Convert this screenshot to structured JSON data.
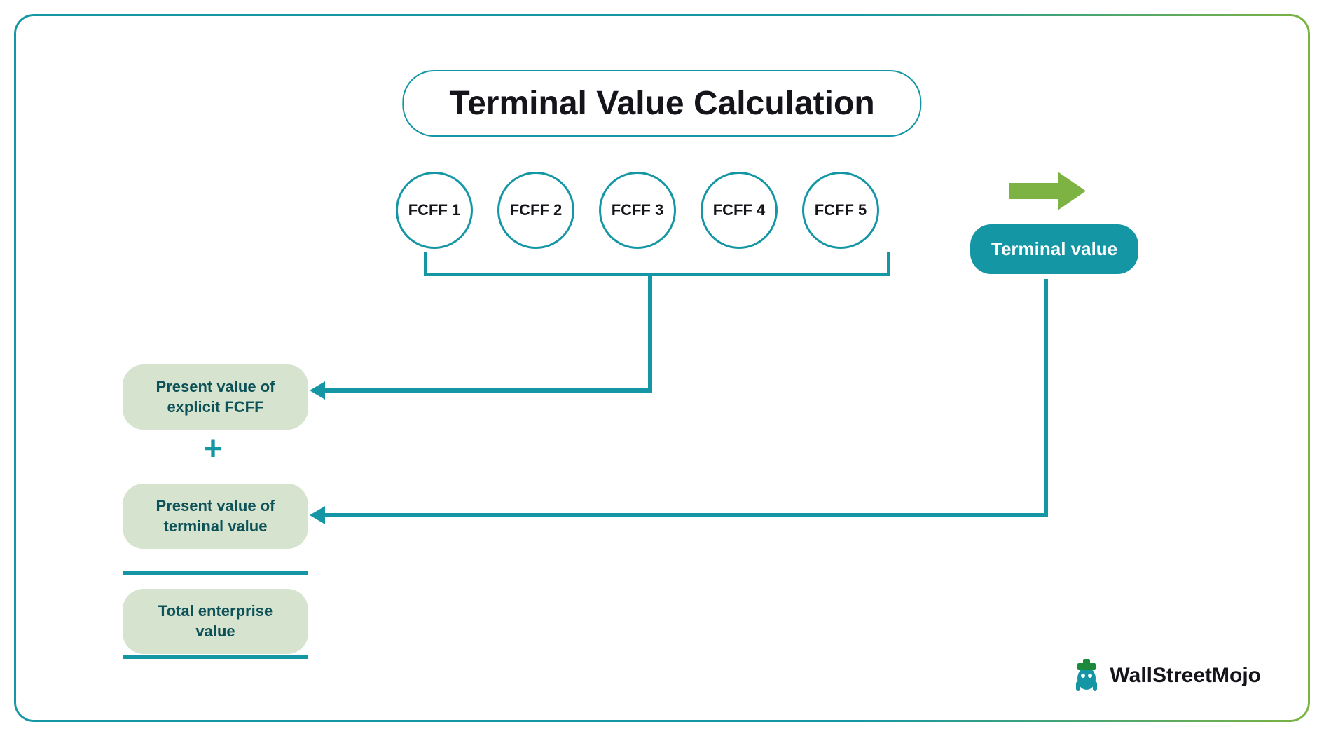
{
  "title": "Terminal Value Calculation",
  "fcff": [
    "FCFF 1",
    "FCFF 2",
    "FCFF 3",
    "FCFF 4",
    "FCFF 5"
  ],
  "terminal_value_label": "Terminal value",
  "boxes": {
    "pv_explicit": "Present value of explicit FCFF",
    "pv_terminal": "Present value of terminal value",
    "total_ev": "Total enterprise value"
  },
  "plus_symbol": "+",
  "logo_text": "WallStreetMojo",
  "colors": {
    "teal": "#1596a5",
    "green": "#7cb342",
    "light_green_fill": "#d6e3ce",
    "dark_teal_text": "#0e5259"
  }
}
